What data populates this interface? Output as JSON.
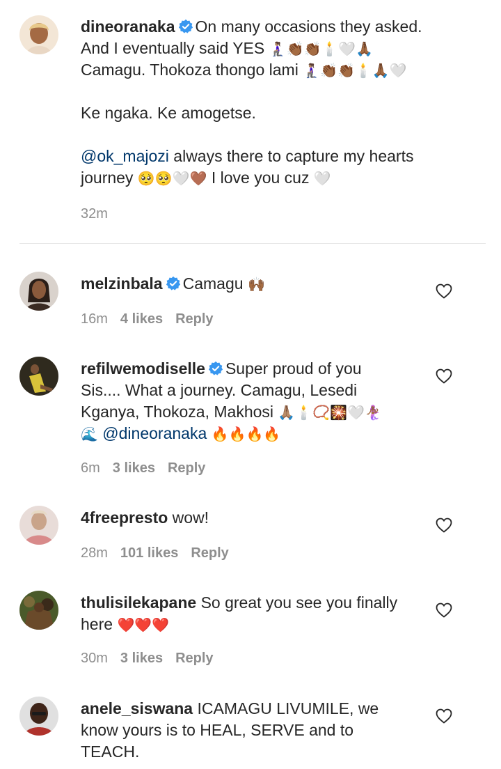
{
  "main_comment": {
    "username": "dineoranaka",
    "line1": "On many occasions they asked.",
    "line2": "And I eventually said YES",
    "line2_emoji": "🧎🏽‍♀️👏🏾👏🏾🕯️🤍🙏🏾",
    "line3": "Camagu. Thokoza thongo lami",
    "line3_emoji": "🧎🏽‍♀️👏🏾👏🏾🕯️🙏🏾🤍",
    "line4": "Ke ngaka. Ke amogetse.",
    "mention": "@ok_majozi",
    "line5": "always there to capture my hearts",
    "line6_start": "journey",
    "line6_emoji": "🥺🥺🤍🤎",
    "line6_end": "I love you cuz",
    "line6_end_emoji": "🤍",
    "time": "32m"
  },
  "replies": [
    {
      "username": "melzinbala",
      "verified": true,
      "text": "Camagu",
      "emoji": "🙌🏾",
      "time": "16m",
      "likes": "4 likes",
      "reply": "Reply"
    },
    {
      "username": "refilwemodiselle",
      "verified": true,
      "text_l1": "Super proud of you",
      "text_l2": "Sis.... What a journey. Camagu, Lesedi",
      "text_l3": "Kganya, Thokoza, Makhosi",
      "emoji_l3": "🙏🏽🕯️📿🎇🤍🧜🏾‍♀️",
      "emoji_l4a": "🌊",
      "mention": "@dineoranaka",
      "emoji_l4b": "🔥🔥🔥🔥",
      "time": "6m",
      "likes": "3 likes",
      "reply": "Reply"
    },
    {
      "username": "4freepresto",
      "verified": false,
      "text": "wow!",
      "time": "28m",
      "likes": "101 likes",
      "reply": "Reply"
    },
    {
      "username": "thulisilekapane",
      "verified": false,
      "text_l1": "So great you see you finally",
      "text_l2": "here",
      "emoji_l2": "❤️❤️❤️",
      "time": "30m",
      "likes": "3 likes",
      "reply": "Reply"
    },
    {
      "username": "anele_siswana",
      "verified": false,
      "text_l1": "ICAMAGU LIVUMILE, we",
      "text_l2": "know yours is to HEAL, SERVE and to",
      "text_l3": "TEACH."
    }
  ],
  "colors": {
    "text": "#262626",
    "meta": "#8e8e8e",
    "mention": "#00376b",
    "verified": "#3897f0",
    "heart_fill": "#e0245e"
  }
}
